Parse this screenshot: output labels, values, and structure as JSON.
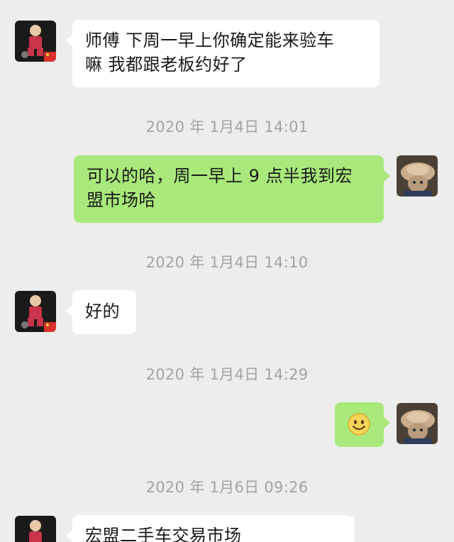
{
  "messages": [
    {
      "side": "left",
      "type": "text",
      "text_line1": "师傅   下周一早上你确定能来验车",
      "text_line2": "嘛   我都跟老板约好了"
    },
    {
      "type": "timestamp",
      "text": "2020 年 1月4日  14:01"
    },
    {
      "side": "right",
      "type": "text",
      "text_line1": "可以的哈，周一早上 9 点半我到宏",
      "text_line2": "盟市场哈"
    },
    {
      "type": "timestamp",
      "text": "2020 年 1月4日  14:10"
    },
    {
      "side": "left",
      "type": "text",
      "text": "好的"
    },
    {
      "type": "timestamp",
      "text": "2020 年 1月4日  14:29"
    },
    {
      "side": "right",
      "type": "emoji",
      "emoji": "smiley-face-icon"
    },
    {
      "type": "timestamp",
      "text": "2020 年 1月6日  09:26"
    },
    {
      "side": "left",
      "type": "text",
      "text": "宏盟二手车交易市场"
    }
  ],
  "colors": {
    "background": "#ededed",
    "incoming_bubble": "#ffffff",
    "outgoing_bubble": "#a9e97b",
    "timestamp_text": "#a3a3a3",
    "message_text": "#191919"
  }
}
